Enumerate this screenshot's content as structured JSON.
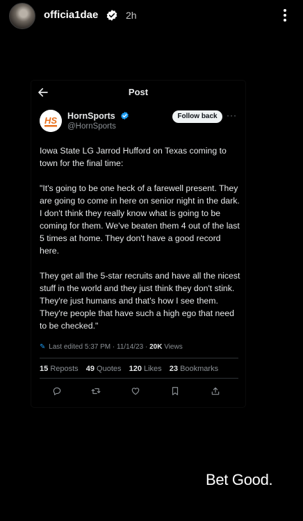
{
  "story": {
    "username": "officia1dae",
    "time_ago": "2h",
    "caption": "Bet Good."
  },
  "post": {
    "nav_title": "Post",
    "author_name": "HornSports",
    "author_handle": "@HornSports",
    "logo_text": "HS",
    "follow_label": "Follow back",
    "more_label": "···",
    "paragraphs": [
      "Iowa State LG Jarrod Hufford on Texas coming to town for the final time:",
      "\"It's going to be one heck of a farewell present. They are going to come in here on senior night in the dark. I don't think they really know what is going to be coming for them. We've beaten them 4 out of the last 5 times at home. They don't have a good record here.",
      "They get all the 5-star recruits and have all the nicest stuff in the world and they just think they don't stink. They're just humans and that's how I see them. They're people that have such a high ego that need to be checked.\""
    ],
    "edited_label": "Last edited 5:37 PM · 11/14/23 ·",
    "views_count": "20K",
    "views_label": "Views",
    "stats": {
      "reposts_count": "15",
      "reposts_label": "Reposts",
      "quotes_count": "49",
      "quotes_label": "Quotes",
      "likes_count": "120",
      "likes_label": "Likes",
      "bookmarks_count": "23",
      "bookmarks_label": "Bookmarks"
    },
    "icons": [
      "reply-icon",
      "repost-icon",
      "like-icon",
      "bookmark-icon",
      "share-icon"
    ]
  },
  "colors": {
    "background": "#000000",
    "accent_blue": "#1d9bf0",
    "muted_text": "#8b9095",
    "logo_orange": "#e8711e"
  }
}
